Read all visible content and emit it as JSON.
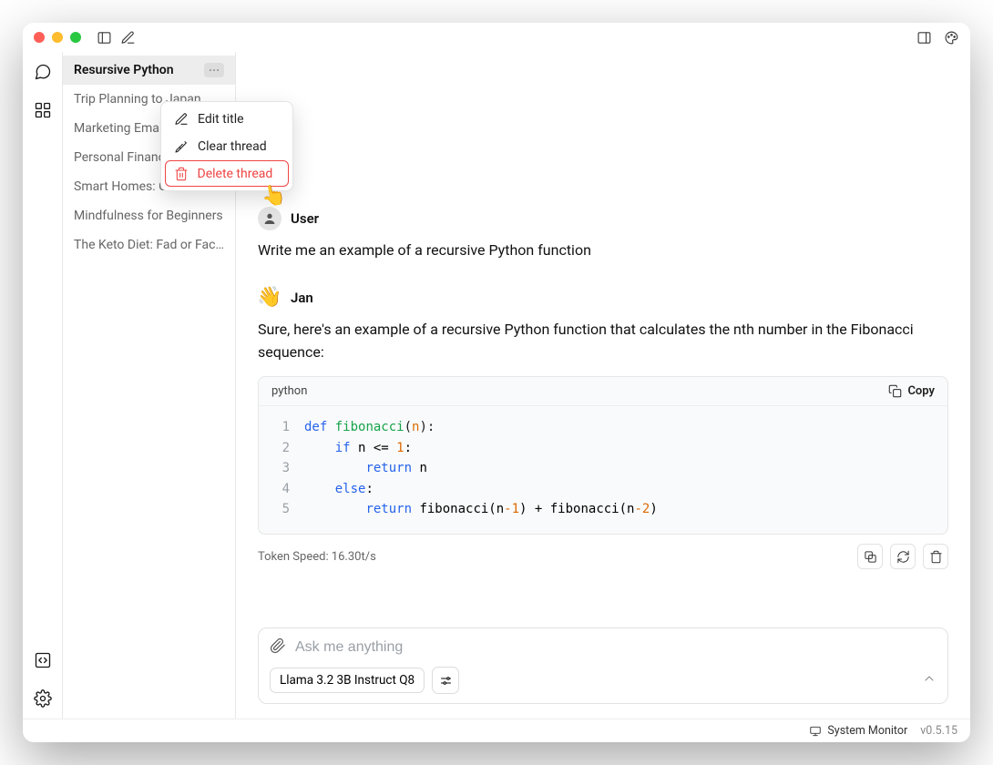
{
  "sidebar": {
    "threads": [
      {
        "title": "Resursive Python",
        "active": true
      },
      {
        "title": "Trip Planning to Japan"
      },
      {
        "title": "Marketing Email Drafts"
      },
      {
        "title": "Personal Finance Tips"
      },
      {
        "title": "Smart Homes: Convenience"
      },
      {
        "title": "Mindfulness for Beginners"
      },
      {
        "title": "The Keto Diet: Fad or Fact?"
      }
    ]
  },
  "context_menu": {
    "edit": "Edit title",
    "clear": "Clear thread",
    "delete": "Delete thread"
  },
  "chat": {
    "user": {
      "name": "User",
      "text": "Write me an example of a recursive Python function"
    },
    "assistant": {
      "name": "Jan",
      "avatar": "👋",
      "text": "Sure, here's an example of a recursive Python function that calculates the nth number in the Fibonacci sequence:",
      "code_lang": "python",
      "copy_label": "Copy",
      "code": {
        "l1": {
          "kw1": "def",
          "fn": "fibonacci",
          "p1": "(",
          "arg": "n",
          "p2": "):"
        },
        "l2": {
          "kw": "if",
          "rest": " n <= ",
          "num": "1",
          "colon": ":"
        },
        "l3": {
          "kw": "return",
          "rest": " n"
        },
        "l4": {
          "kw": "else",
          "colon": ":"
        },
        "l5": {
          "kw": "return",
          "rest1": " fibonacci(n",
          "m1": "-1",
          "rest2": ") + fibonacci(n",
          "m2": "-2",
          "rest3": ")"
        }
      },
      "token_speed": "Token Speed: 16.30t/s"
    }
  },
  "input": {
    "placeholder": "Ask me anything",
    "model": "Llama 3.2 3B Instruct Q8"
  },
  "bottom": {
    "system_monitor": "System Monitor",
    "version": "v0.5.15"
  }
}
